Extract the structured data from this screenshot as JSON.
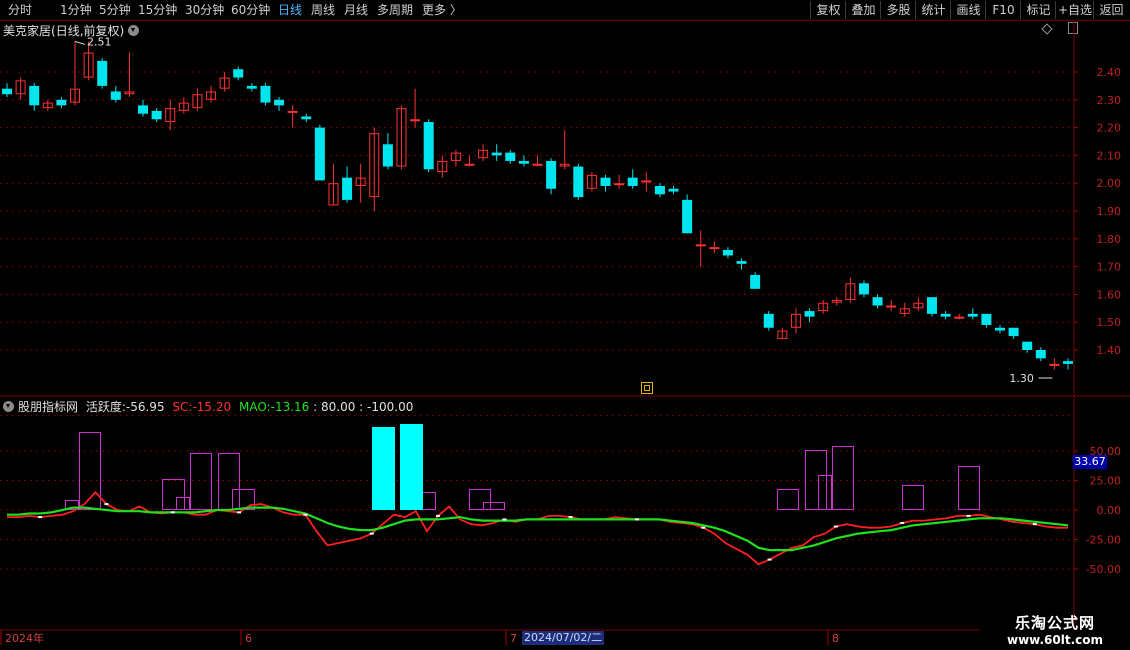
{
  "toolbar": {
    "left_items": [
      "分时",
      "1分钟",
      "5分钟",
      "15分钟",
      "30分钟",
      "60分钟",
      "日线",
      "周线",
      "月线",
      "多周期",
      "更多 〉"
    ],
    "active": "日线",
    "right_items": [
      "复权",
      "叠加",
      "多股",
      "统计",
      "画线",
      "F10",
      "标记",
      "+自选",
      "返回"
    ]
  },
  "stock": {
    "name": "美克家居",
    "period_label": "(日线,前复权)"
  },
  "indicator": {
    "name": "股朋指标网",
    "huoyue_label": "活跃度:",
    "huoyue_value": "-56.95",
    "sc_label": "SC:",
    "sc_value": "-15.20",
    "mao_label": "MAO:",
    "mao_value": "-13.16",
    "level1": ": 80.00",
    "level2": ": -100.00",
    "current_badge": "33.67"
  },
  "price_axis": {
    "ticks": [
      "2.40",
      "2.30",
      "2.20",
      "2.10",
      "2.00",
      "1.90",
      "1.80",
      "1.70",
      "1.60",
      "1.50",
      "1.40"
    ]
  },
  "indicator_axis": {
    "ticks": [
      "50.00",
      "25.00",
      "0.00",
      "-25.00",
      "-50.00"
    ]
  },
  "annotations": {
    "high_label": "2.51",
    "low_label": "1.30"
  },
  "time_axis": {
    "labels": [
      "2024年",
      "6",
      "7",
      "8"
    ],
    "cursor_date": "2024/07/02/二"
  },
  "watermark": {
    "line1": "乐淘公式网",
    "line2": "www.60lt.com"
  },
  "colors": {
    "up": "#ff3232",
    "down": "#00e5ee",
    "sc_line": "#ff2020",
    "mao_line": "#1ee01e",
    "bars_outline": "#cc33cc",
    "bars_fill": "#00ffff"
  },
  "chart_data": [
    {
      "type": "candlestick",
      "title": "美克家居(日线,前复权)",
      "ylim": [
        1.3,
        2.51
      ],
      "columns": [
        "open",
        "close",
        "high",
        "low"
      ],
      "candles": [
        [
          2.34,
          2.32,
          2.36,
          2.31
        ],
        [
          2.32,
          2.37,
          2.38,
          2.3
        ],
        [
          2.35,
          2.28,
          2.36,
          2.26
        ],
        [
          2.27,
          2.29,
          2.3,
          2.26
        ],
        [
          2.3,
          2.28,
          2.31,
          2.27
        ],
        [
          2.29,
          2.34,
          2.51,
          2.28
        ],
        [
          2.38,
          2.47,
          2.51,
          2.37
        ],
        [
          2.44,
          2.35,
          2.45,
          2.34
        ],
        [
          2.33,
          2.3,
          2.35,
          2.29
        ],
        [
          2.32,
          2.33,
          2.47,
          2.31
        ],
        [
          2.28,
          2.25,
          2.3,
          2.24
        ],
        [
          2.26,
          2.23,
          2.27,
          2.22
        ],
        [
          2.22,
          2.27,
          2.3,
          2.19
        ],
        [
          2.26,
          2.29,
          2.31,
          2.25
        ],
        [
          2.27,
          2.32,
          2.34,
          2.26
        ],
        [
          2.3,
          2.33,
          2.35,
          2.29
        ],
        [
          2.34,
          2.38,
          2.4,
          2.33
        ],
        [
          2.41,
          2.38,
          2.42,
          2.37
        ],
        [
          2.35,
          2.34,
          2.36,
          2.33
        ],
        [
          2.35,
          2.29,
          2.36,
          2.28
        ],
        [
          2.3,
          2.28,
          2.31,
          2.26
        ],
        [
          2.26,
          2.26,
          2.28,
          2.2
        ],
        [
          2.24,
          2.23,
          2.25,
          2.22
        ],
        [
          2.2,
          2.01,
          2.21,
          2.01
        ],
        [
          1.92,
          2.0,
          2.07,
          1.92
        ],
        [
          2.02,
          1.94,
          2.06,
          1.93
        ],
        [
          1.99,
          2.02,
          2.07,
          1.93
        ],
        [
          1.95,
          2.18,
          2.2,
          1.9
        ],
        [
          2.14,
          2.06,
          2.18,
          2.05
        ],
        [
          2.06,
          2.27,
          2.28,
          2.05
        ],
        [
          2.23,
          2.23,
          2.34,
          2.2
        ],
        [
          2.22,
          2.05,
          2.23,
          2.04
        ],
        [
          2.04,
          2.08,
          2.1,
          2.02
        ],
        [
          2.08,
          2.11,
          2.12,
          2.06
        ],
        [
          2.07,
          2.07,
          2.1,
          2.06
        ],
        [
          2.09,
          2.12,
          2.14,
          2.08
        ],
        [
          2.11,
          2.1,
          2.14,
          2.08
        ],
        [
          2.11,
          2.08,
          2.12,
          2.07
        ],
        [
          2.08,
          2.07,
          2.1,
          2.06
        ],
        [
          2.07,
          2.07,
          2.1,
          2.06
        ],
        [
          2.08,
          1.98,
          2.09,
          1.96
        ],
        [
          2.06,
          2.07,
          2.19,
          2.05
        ],
        [
          2.06,
          1.95,
          2.07,
          1.94
        ],
        [
          1.98,
          2.03,
          2.04,
          1.97
        ],
        [
          2.02,
          1.99,
          2.03,
          1.97
        ],
        [
          2.0,
          2.0,
          2.03,
          1.98
        ],
        [
          2.02,
          1.99,
          2.05,
          1.98
        ],
        [
          2.01,
          2.01,
          2.04,
          1.97
        ],
        [
          1.99,
          1.96,
          2.0,
          1.95
        ],
        [
          1.98,
          1.97,
          1.99,
          1.96
        ],
        [
          1.94,
          1.82,
          1.96,
          1.82
        ],
        [
          1.78,
          1.78,
          1.83,
          1.7
        ],
        [
          1.77,
          1.77,
          1.79,
          1.75
        ],
        [
          1.76,
          1.74,
          1.77,
          1.73
        ],
        [
          1.72,
          1.71,
          1.73,
          1.69
        ],
        [
          1.67,
          1.62,
          1.68,
          1.62
        ],
        [
          1.53,
          1.48,
          1.54,
          1.47
        ],
        [
          1.44,
          1.47,
          1.48,
          1.44
        ],
        [
          1.48,
          1.53,
          1.55,
          1.46
        ],
        [
          1.54,
          1.52,
          1.55,
          1.5
        ],
        [
          1.54,
          1.57,
          1.58,
          1.53
        ],
        [
          1.57,
          1.58,
          1.59,
          1.56
        ],
        [
          1.58,
          1.64,
          1.66,
          1.57
        ],
        [
          1.64,
          1.6,
          1.65,
          1.59
        ],
        [
          1.59,
          1.56,
          1.6,
          1.55
        ],
        [
          1.56,
          1.56,
          1.58,
          1.54
        ],
        [
          1.53,
          1.55,
          1.57,
          1.52
        ],
        [
          1.55,
          1.57,
          1.59,
          1.54
        ],
        [
          1.59,
          1.53,
          1.59,
          1.52
        ],
        [
          1.53,
          1.52,
          1.54,
          1.51
        ],
        [
          1.52,
          1.52,
          1.53,
          1.51
        ],
        [
          1.53,
          1.52,
          1.55,
          1.51
        ],
        [
          1.53,
          1.49,
          1.53,
          1.48
        ],
        [
          1.48,
          1.47,
          1.49,
          1.46
        ],
        [
          1.48,
          1.45,
          1.48,
          1.44
        ],
        [
          1.43,
          1.4,
          1.43,
          1.39
        ],
        [
          1.4,
          1.37,
          1.41,
          1.36
        ],
        [
          1.35,
          1.35,
          1.37,
          1.33
        ],
        [
          1.36,
          1.35,
          1.37,
          1.33
        ]
      ]
    },
    {
      "type": "line",
      "title": "股朋指标网",
      "ylim": [
        -100,
        80
      ],
      "series": [
        {
          "name": "SC",
          "values": [
            -6,
            -6,
            -5,
            -6,
            -5,
            -4,
            -1,
            5,
            15,
            5,
            0,
            -1,
            3,
            -2,
            -3,
            -2,
            -2,
            -4,
            -4,
            0,
            -1,
            -2,
            4,
            5,
            2,
            -2,
            -4,
            -4,
            -18,
            -30,
            -28,
            -26,
            -24,
            -20,
            -12,
            -4,
            -6,
            -1,
            -18,
            -5,
            3,
            -8,
            -12,
            -13,
            -11,
            -8,
            -10,
            -8,
            -8,
            -5,
            -5,
            -6,
            -8,
            -8,
            -8,
            -6,
            -7,
            -8,
            -8,
            -8,
            -10,
            -11,
            -12,
            -15,
            -20,
            -28,
            -33,
            -38,
            -46,
            -42,
            -37,
            -32,
            -30,
            -23,
            -20,
            -14,
            -12,
            -14,
            -15,
            -15,
            -14,
            -11,
            -9,
            -9,
            -8,
            -7,
            -5,
            -5,
            -4,
            -6,
            -8,
            -10,
            -11,
            -12,
            -14,
            -15,
            -15
          ]
        },
        {
          "name": "MAO",
          "values": [
            -4,
            -4,
            -3,
            -3,
            -2,
            0,
            2,
            2,
            1,
            0,
            -1,
            -1,
            -1,
            -2,
            -2,
            -2,
            -2,
            -2,
            -1,
            0,
            0,
            1,
            2,
            2,
            2,
            1,
            -1,
            -3,
            -7,
            -11,
            -14,
            -16,
            -17,
            -17,
            -15,
            -12,
            -9,
            -8,
            -8,
            -8,
            -7,
            -6,
            -8,
            -9,
            -9,
            -9,
            -9,
            -8,
            -8,
            -8,
            -8,
            -8,
            -8,
            -8,
            -8,
            -8,
            -8,
            -8,
            -8,
            -8,
            -9,
            -10,
            -11,
            -13,
            -15,
            -18,
            -22,
            -26,
            -32,
            -34,
            -34,
            -34,
            -32,
            -30,
            -27,
            -24,
            -22,
            -20,
            -19,
            -18,
            -17,
            -15,
            -13,
            -12,
            -11,
            -10,
            -9,
            -8,
            -7,
            -7,
            -7,
            -8,
            -9,
            -10,
            -11,
            -12,
            -13
          ]
        }
      ]
    }
  ]
}
